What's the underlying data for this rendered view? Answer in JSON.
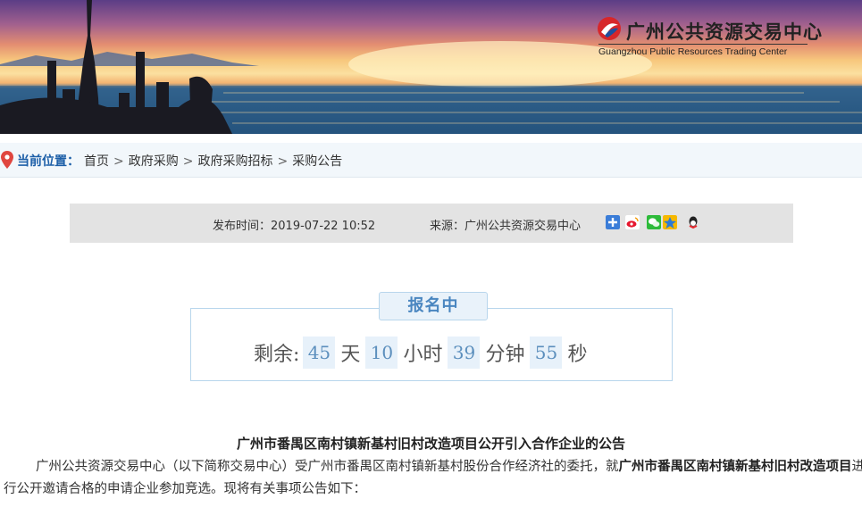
{
  "header": {
    "logo_cn": "广州公共资源交易中心",
    "logo_en": "Guangzhou Public Resources Trading Center"
  },
  "breadcrumb": {
    "label": "当前位置：",
    "items": [
      "首页",
      "政府采购",
      "政府采购招标",
      "采购公告"
    ]
  },
  "meta": {
    "publish_time": "发布时间：2019-07-22 10:52",
    "source": "来源：广州公共资源交易中心",
    "share_icons": [
      "plus-share-icon",
      "weibo-icon",
      "wechat-icon",
      "qzone-icon",
      "qq-icon"
    ]
  },
  "countdown": {
    "status": "报名中",
    "prefix": "剩余:",
    "days": "45",
    "days_unit": "天",
    "hours": "10",
    "hours_unit": "小时",
    "minutes": "39",
    "minutes_unit": "分钟",
    "seconds": "55",
    "seconds_unit": "秒"
  },
  "article": {
    "title": "广州市番禺区南村镇新基村旧村改造项目公开引入合作企业的公告",
    "p1_a": "广州公共资源交易中心（以下简称交易中心）受广州市番禺区南村镇新基村股份合作经济社的委托，就",
    "p1_b": "广州市番禺区南村镇新基村旧村改造项目",
    "p1_c": "进行公开邀请合格的申请企业参加竞选。现将有关事项公告如下："
  },
  "colors": {
    "accent": "#1d5fa8",
    "countdown_num_bg": "#e7f1fa",
    "meta_bg": "#e3e3e3"
  }
}
